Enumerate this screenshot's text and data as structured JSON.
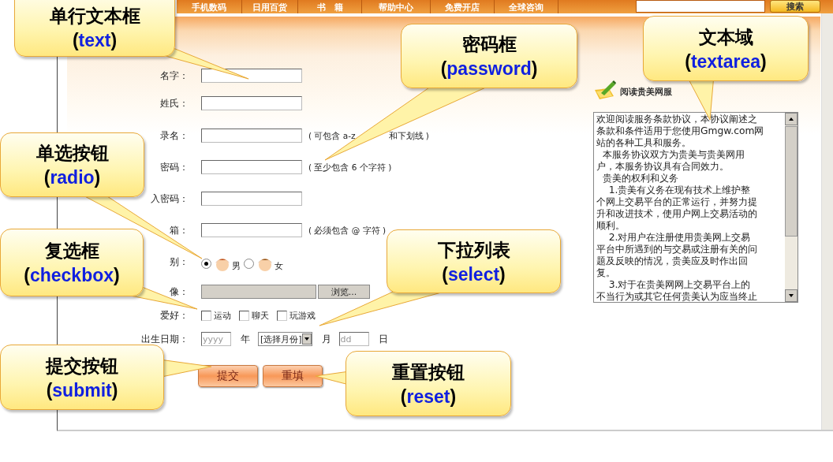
{
  "nav": {
    "items": [
      "手机数码",
      "日用百货",
      "书　籍",
      "帮助中心",
      "免费开店",
      "全球咨询"
    ],
    "search_button": "搜索"
  },
  "form": {
    "rows": [
      {
        "kind": "text",
        "label": "名字："
      },
      {
        "kind": "text",
        "label": "姓氏："
      },
      {
        "kind": "text",
        "label": "录名：",
        "hints": [
          "( 可包含 a-z",
          "和下划线 )"
        ]
      },
      {
        "kind": "password",
        "label": "密码：",
        "hints": [
          "( 至少包含 6 个字符 )"
        ]
      },
      {
        "kind": "password",
        "label": "入密码："
      },
      {
        "kind": "text",
        "label": "箱：",
        "hints": [
          "( 必须包含 @ 字符 )"
        ]
      },
      {
        "kind": "radio",
        "label": "别：",
        "options": [
          {
            "label": "男",
            "selected": true
          },
          {
            "label": "女",
            "selected": false
          }
        ]
      },
      {
        "kind": "file",
        "label": "像：",
        "button": "浏览..."
      },
      {
        "kind": "checkbox",
        "label": "爱好：",
        "options": [
          {
            "label": "运动",
            "checked": false
          },
          {
            "label": "聊天",
            "checked": false
          },
          {
            "label": "玩游戏",
            "checked": false
          }
        ]
      },
      {
        "kind": "date",
        "label": "出生日期：",
        "year_placeholder": "yyyy",
        "year_unit": "年",
        "month_select": "[选择月份]",
        "month_unit": "月",
        "day_placeholder": "dd",
        "day_unit": "日"
      }
    ],
    "buttons": [
      {
        "label": "提交"
      },
      {
        "label": "重填"
      }
    ]
  },
  "agreement": {
    "title": "阅读贵美网服",
    "lines": [
      "欢迎阅读服务条款协议，本协议阐述之",
      "条款和条件适用于您使用Gmgw.com网",
      "站的各种工具和服务。",
      "  本服务协议双方为贵美与贵美网用",
      "户，本服务协议具有合同效力。",
      "  贵美的权利和义务",
      "    1.贵美有义务在现有技术上维护整",
      "个网上交易平台的正常运行，并努力提",
      "升和改进技术，使用户网上交易活动的",
      "顺利。",
      "    2.对用户在注册使用贵美网上交易",
      "平台中所遇到的与交易或注册有关的问",
      "题及反映的情况，贵美应及时作出回",
      "复。",
      "    3.对于在贵美网网上交易平台上的",
      "不当行为或其它任何贵美认为应当终止"
    ]
  },
  "callouts": [
    {
      "title": "单行文本框",
      "tag": "(**text**)"
    },
    {
      "title": "密码框",
      "tag": "(**password**)"
    },
    {
      "title": "文本域",
      "tag": "(**textarea**)"
    },
    {
      "title": "单选按钮",
      "tag": "(**radio**)"
    },
    {
      "title": "复选框",
      "tag": "(**checkbox**)"
    },
    {
      "title": "下拉列表",
      "tag": "(**select**)"
    },
    {
      "title": "提交按钮",
      "tag": "(**submit**)"
    },
    {
      "title": "重置按钮",
      "tag": "(**reset**)"
    }
  ]
}
